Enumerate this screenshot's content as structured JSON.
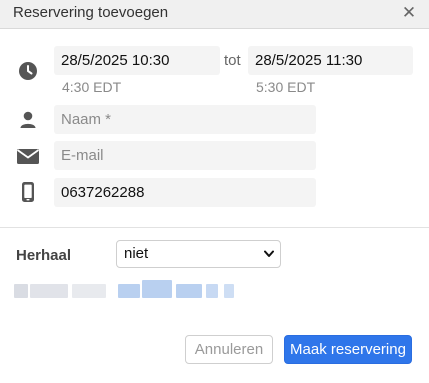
{
  "dialog": {
    "title": "Reservering toevoegen",
    "close_icon": "close-icon"
  },
  "time": {
    "start_value": "28/5/2025  10:30",
    "start_tz": "4:30 EDT",
    "separator": "tot",
    "end_value": "28/5/2025  11:30",
    "end_tz": "5:30 EDT",
    "icon": "clock-icon"
  },
  "name_field": {
    "placeholder": "Naam *",
    "icon": "person-icon"
  },
  "email_field": {
    "placeholder": "E-mail",
    "icon": "envelope-icon"
  },
  "phone_field": {
    "value": "0637262288",
    "icon": "phone-icon"
  },
  "repeat": {
    "label": "Herhaal",
    "selected": "niet"
  },
  "buttons": {
    "cancel_label": "Annuleren",
    "submit_label": "Maak reservering"
  },
  "colors": {
    "primary": "#2f76ea",
    "icon": "#555555",
    "field_bg": "#f4f4f4"
  }
}
